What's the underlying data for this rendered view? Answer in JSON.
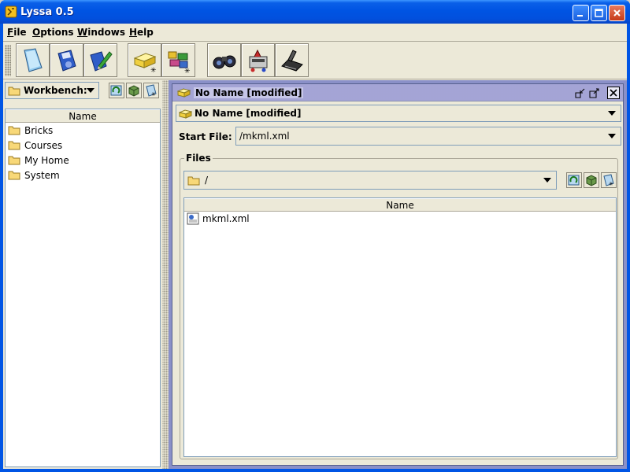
{
  "window": {
    "title": "Lyssa 0.5"
  },
  "menu": [
    {
      "label": "File",
      "mnemonic": "F",
      "rest": "ile"
    },
    {
      "label": "Options",
      "mnemonic": "O",
      "rest": "ptions"
    },
    {
      "label": "Windows",
      "mnemonic": "W",
      "rest": "indows"
    },
    {
      "label": "Help",
      "mnemonic": "H",
      "rest": "elp"
    }
  ],
  "toolbar": {
    "buttons": [
      "new-document-icon",
      "save-disk-icon",
      "edit-disk-icon",
      "new-brick-icon",
      "new-bricks-icon",
      "find-binoculars-icon",
      "machine-icon",
      "scanner-icon"
    ]
  },
  "left": {
    "workspace_label": "Workbench:",
    "column_header": "Name",
    "items": [
      "Bricks",
      "Courses",
      "My Home",
      "System"
    ]
  },
  "right": {
    "frame_title": "No Name [modified]",
    "project_combo": "No Name [modified]",
    "start_file_label": "Start File:",
    "start_file_value": "/mkml.xml",
    "files_legend": "Files",
    "path_value": "/",
    "column_header": "Name",
    "files": [
      "mkml.xml"
    ]
  }
}
